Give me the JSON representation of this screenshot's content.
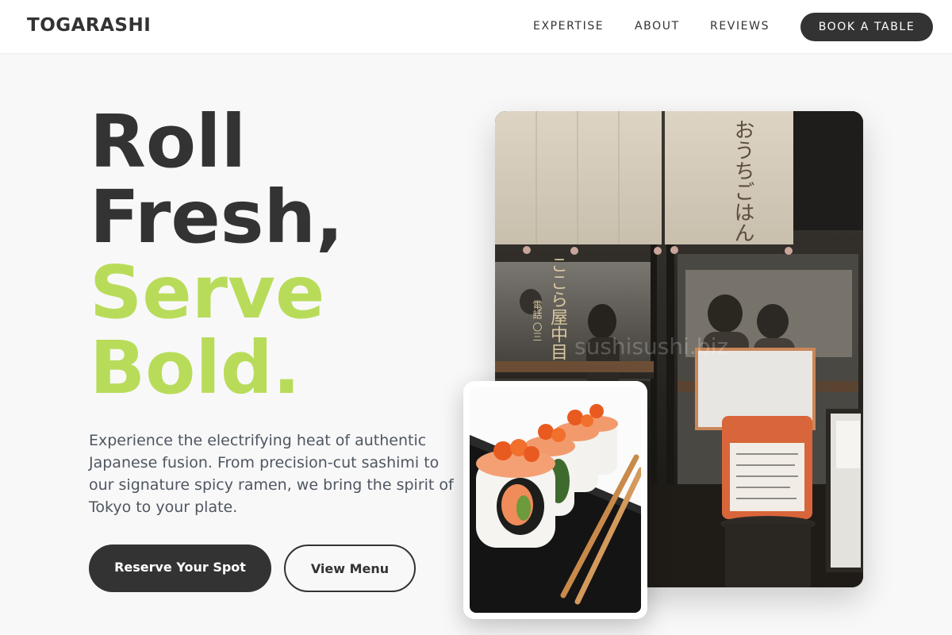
{
  "brand": {
    "logo": "TOGARASHI"
  },
  "nav": {
    "links": [
      "EXPERTISE",
      "ABOUT",
      "REVIEWS"
    ],
    "cta": "BOOK A TABLE"
  },
  "hero": {
    "headline": [
      "Roll",
      "Fresh,",
      "Serve",
      "Bold."
    ],
    "description": "Experience the electrifying heat of authentic Japanese fusion. From precision-cut sashimi to our signature spicy ramen, we bring the spirit of Tokyo to your plate.",
    "primary_button": "Reserve Your Spot",
    "secondary_button": "View Menu"
  },
  "images": {
    "restaurant_sign": "おうちごはん",
    "restaurant_window_text": "ここら屋中目",
    "restaurant_phone_text": "電話 〇三",
    "watermark": "sushisushi.biz"
  },
  "colors": {
    "dark": "#333333",
    "accent": "#b8dc5a",
    "background": "#f8f8f8",
    "body_text": "#4f5661"
  }
}
